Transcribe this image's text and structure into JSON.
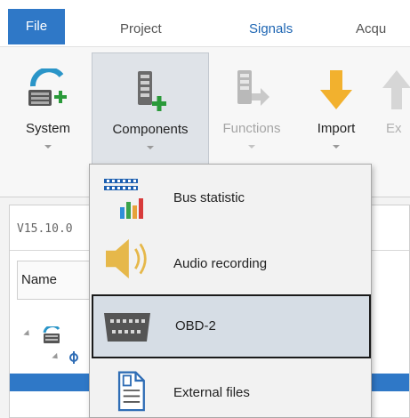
{
  "tabs": {
    "file": "File",
    "project": "Project",
    "signals": "Signals",
    "acquisition_partial": "Acqu"
  },
  "ribbon": {
    "system": "System",
    "components": "Components",
    "functions": "Functions",
    "import": "Import",
    "export_partial": "Ex"
  },
  "panel": {
    "version": "V15.10.0",
    "name_header": "Name"
  },
  "components_menu": {
    "items": [
      {
        "label": "Bus statistic",
        "icon": "bus-statistic-icon"
      },
      {
        "label": "Audio recording",
        "icon": "speaker-icon"
      },
      {
        "label": "OBD-2",
        "icon": "obd-connector-icon"
      },
      {
        "label": "External files",
        "icon": "document-icon"
      }
    ],
    "hovered": "OBD-2"
  },
  "colors": {
    "file_tab": "#2f78c7",
    "signals_tab_text": "#1e66b3",
    "selection": "#2f78c7",
    "menu_highlight": "#d6dde5"
  }
}
